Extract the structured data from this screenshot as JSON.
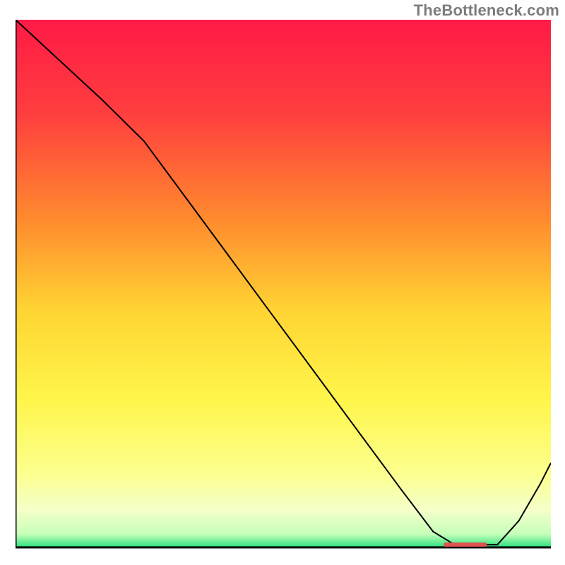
{
  "watermark": "TheBottleneck.com",
  "marker_label": "",
  "chart_data": {
    "type": "line",
    "title": "",
    "xlabel": "",
    "ylabel": "",
    "xlim": [
      0,
      100
    ],
    "ylim": [
      0,
      100
    ],
    "grid": false,
    "axes_visible": {
      "left": true,
      "bottom": true,
      "right": false,
      "top": false
    },
    "background_gradient": {
      "stops": [
        {
          "offset": 0.0,
          "color": "#ff1a46"
        },
        {
          "offset": 0.18,
          "color": "#ff3f3e"
        },
        {
          "offset": 0.38,
          "color": "#ff8b2e"
        },
        {
          "offset": 0.55,
          "color": "#ffd433"
        },
        {
          "offset": 0.72,
          "color": "#fff54a"
        },
        {
          "offset": 0.86,
          "color": "#fcff8e"
        },
        {
          "offset": 0.93,
          "color": "#f4ffc9"
        },
        {
          "offset": 0.975,
          "color": "#c6ffb9"
        },
        {
          "offset": 1.0,
          "color": "#29e07c"
        }
      ]
    },
    "series": [
      {
        "name": "curve",
        "color": "#000000",
        "stroke_width": 2,
        "x": [
          0,
          8,
          16,
          24,
          32,
          40,
          48,
          56,
          64,
          72,
          78,
          82,
          86,
          90,
          94,
          98,
          100
        ],
        "y": [
          100,
          92.5,
          85,
          77,
          66,
          55,
          44,
          33,
          22,
          11,
          3,
          0.5,
          0.5,
          0.5,
          5,
          12,
          16
        ]
      }
    ],
    "marker_band": {
      "x_start": 80,
      "x_end": 88,
      "y": 0.5,
      "color": "#e0524f"
    }
  }
}
